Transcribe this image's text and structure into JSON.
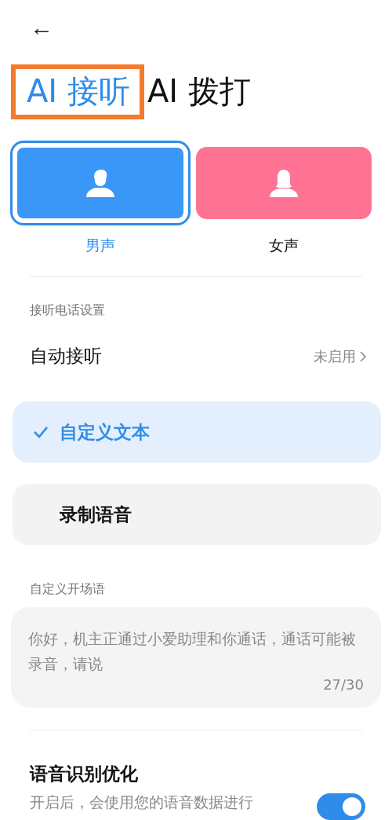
{
  "back_button": {
    "label": "←"
  },
  "tabs": [
    {
      "label": "AI 接听",
      "selected": true,
      "highlighted": true
    },
    {
      "label": "AI 拨打",
      "selected": false,
      "highlighted": false
    }
  ],
  "voices": [
    {
      "label": "男声",
      "kind": "male",
      "color": "#3b97f7",
      "selected": true
    },
    {
      "label": "女声",
      "kind": "female",
      "color": "#fe7393",
      "selected": false
    }
  ],
  "section_title": "接听电话设置",
  "auto_answer": {
    "label": "自动接听",
    "value": "未启用"
  },
  "reply_modes": [
    {
      "label": "自定义文本",
      "selected": true
    },
    {
      "label": "录制语音",
      "selected": false
    }
  ],
  "greeting": {
    "title": "自定义开场语",
    "value": "你好，机主正通过小爱助理和你通话，通话可能被录音，请说",
    "count": "27/30"
  },
  "speech_optimization": {
    "title": "语音识别优化",
    "description": "开启后，会使用您的语音数据进行",
    "on": true
  }
}
